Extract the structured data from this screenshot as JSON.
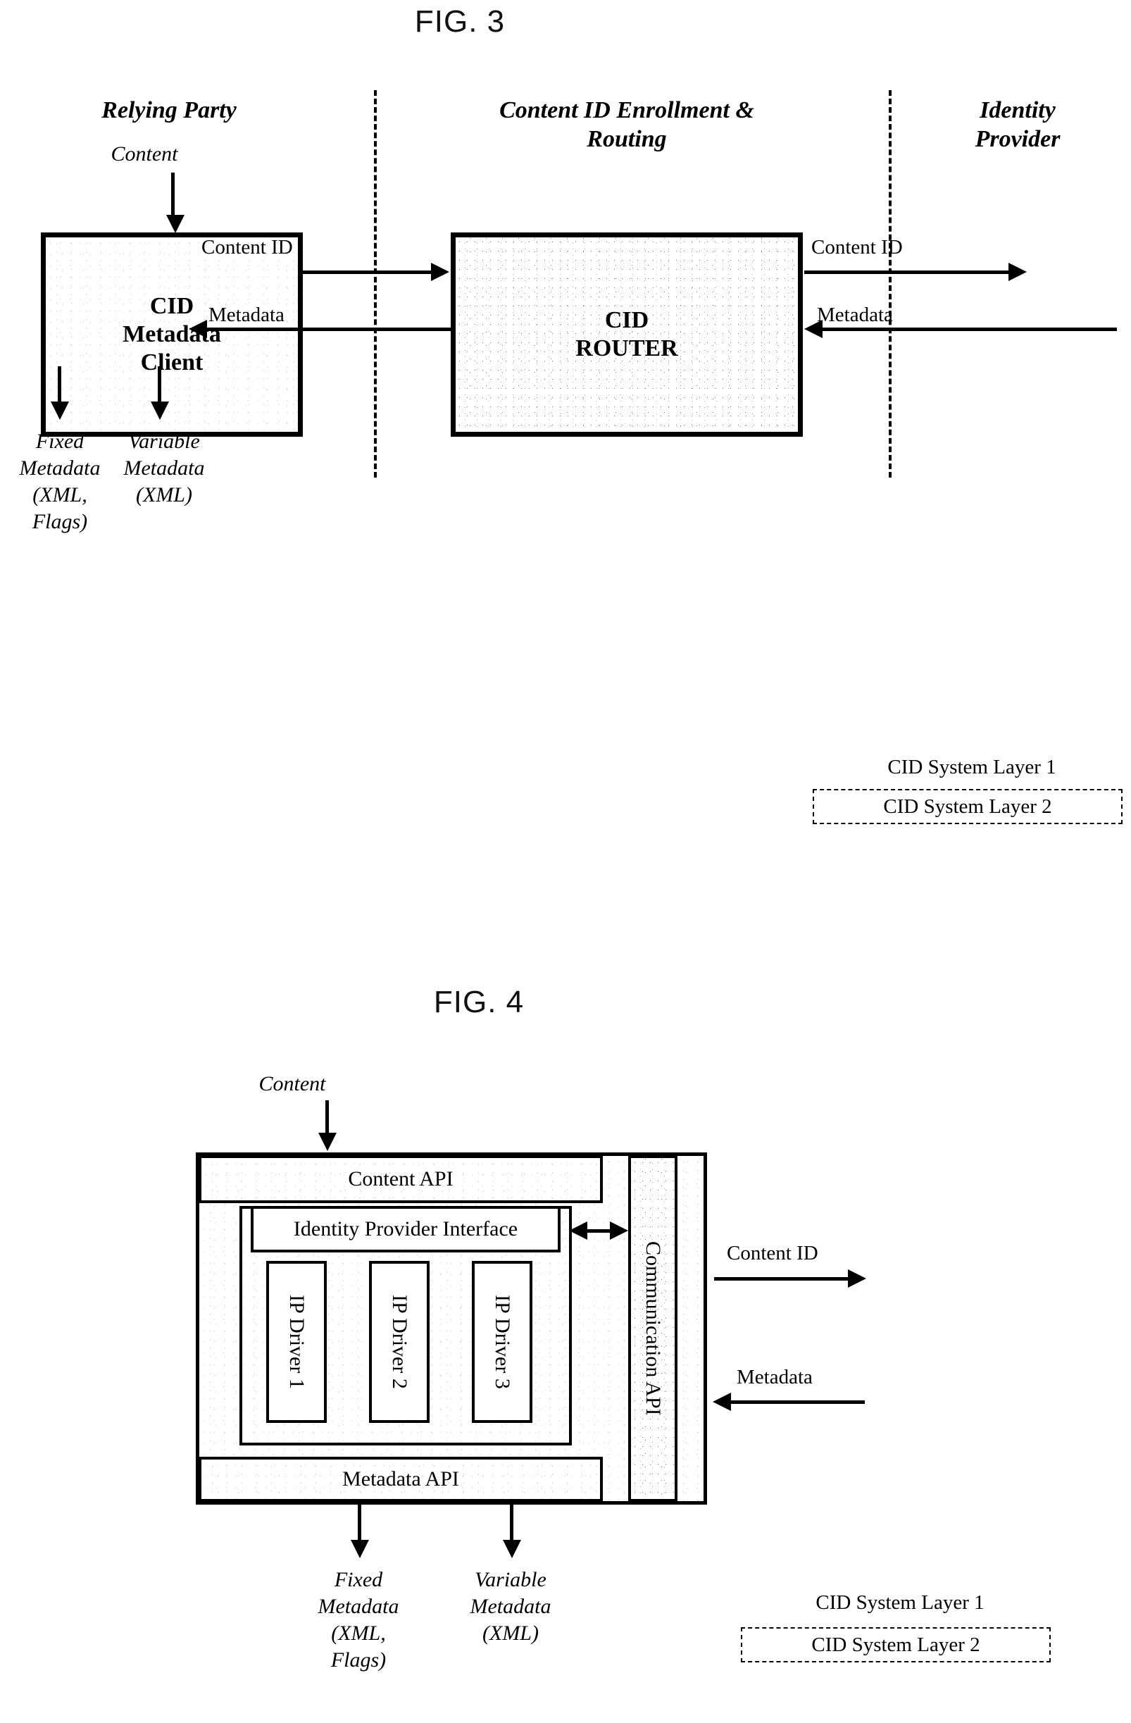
{
  "figures": [
    {
      "caption": "FIG. 3",
      "lanes": [
        {
          "label": "Relying Party"
        },
        {
          "label": "Content ID Enrollment &\nRouting"
        },
        {
          "label": "Identity\nProvider"
        }
      ],
      "input_label": "Content",
      "boxes": [
        {
          "title": "CID\nMetadata\nClient"
        },
        {
          "title": "CID\nROUTER"
        }
      ],
      "flows": [
        {
          "label": "Content ID",
          "direction": "right"
        },
        {
          "label": "Metadata",
          "direction": "left"
        },
        {
          "label": "Content ID",
          "direction": "right"
        },
        {
          "label": "Metadata",
          "direction": "left"
        }
      ],
      "outputs": [
        {
          "label": "Fixed\nMetadata\n(XML,\nFlags)"
        },
        {
          "label": "Variable\nMetadata\n(XML)"
        }
      ],
      "legend": {
        "layer1": "CID System Layer 1",
        "layer2": "CID System Layer 2"
      }
    },
    {
      "caption": "FIG. 4",
      "input_label": "Content",
      "bands": [
        {
          "label": "Content API"
        },
        {
          "label": "Identity Provider Interface"
        },
        {
          "label": "Metadata API"
        }
      ],
      "side_band": {
        "label": "Communication API"
      },
      "drivers": [
        {
          "label": "IP Driver 1"
        },
        {
          "label": "IP Driver 2"
        },
        {
          "label": "IP Driver 3"
        }
      ],
      "flows": [
        {
          "label": "Content ID",
          "direction": "right"
        },
        {
          "label": "Metadata",
          "direction": "left"
        }
      ],
      "outputs": [
        {
          "label": "Fixed\nMetadata\n(XML,\nFlags)"
        },
        {
          "label": "Variable\nMetadata\n(XML)"
        }
      ],
      "legend": {
        "layer1": "CID System Layer 1",
        "layer2": "CID System Layer 2"
      }
    }
  ]
}
